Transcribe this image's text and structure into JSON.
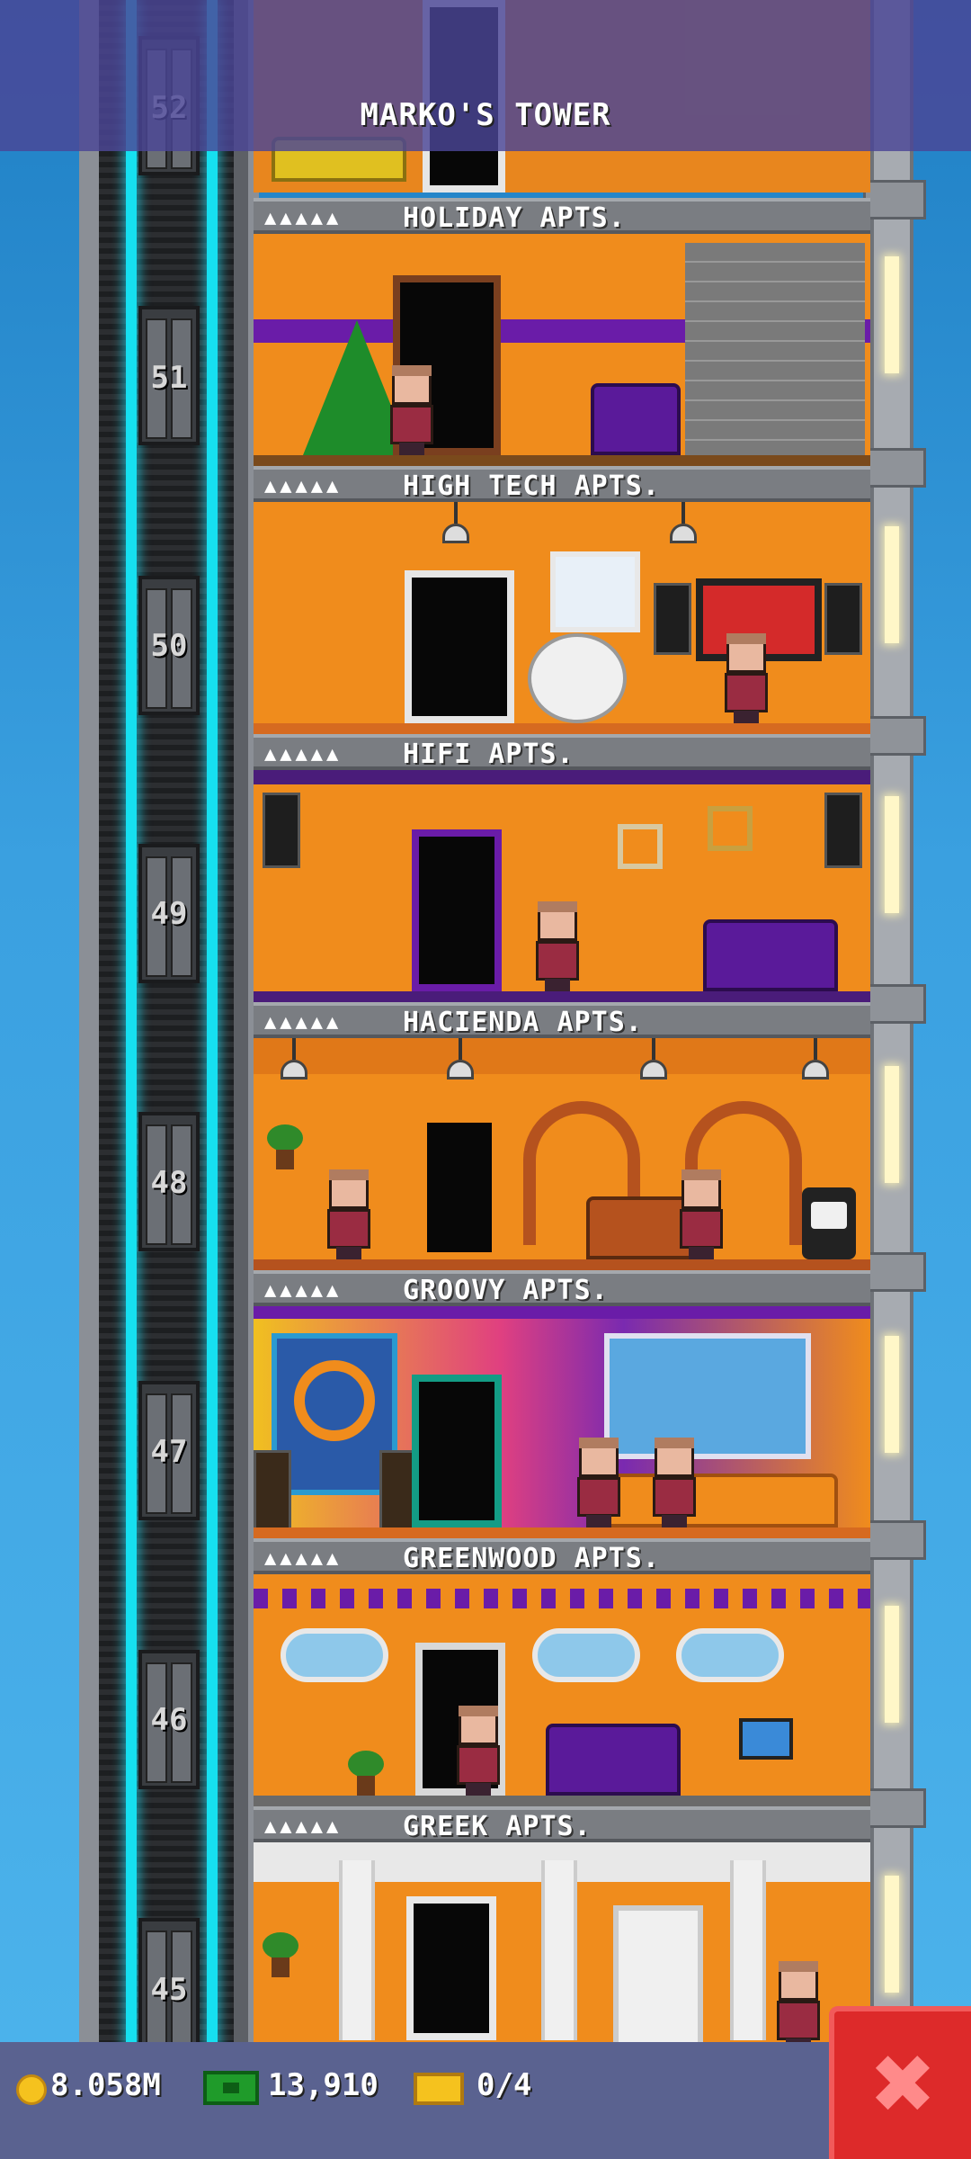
{
  "header": {
    "title": "MARKO'S TOWER"
  },
  "elevator": {
    "floor_numbers": [
      "52",
      "51",
      "50",
      "49",
      "48",
      "47",
      "46",
      "45"
    ]
  },
  "floors": [
    {
      "floor": "51",
      "dots": "▲▲▲▲▲",
      "name": "HOLIDAY APTS.",
      "theme": "holiday"
    },
    {
      "floor": "50",
      "dots": "▲▲▲▲▲",
      "name": "HIGH TECH APTS.",
      "theme": "hightech"
    },
    {
      "floor": "49",
      "dots": "▲▲▲▲▲",
      "name": "HIFI APTS.",
      "theme": "hifi"
    },
    {
      "floor": "48",
      "dots": "▲▲▲▲▲",
      "name": "HACIENDA APTS.",
      "theme": "hacienda"
    },
    {
      "floor": "47",
      "dots": "▲▲▲▲▲",
      "name": "GROOVY APTS.",
      "theme": "groovy"
    },
    {
      "floor": "46",
      "dots": "▲▲▲▲▲",
      "name": "GREENWOOD APTS.",
      "theme": "greenwood"
    },
    {
      "floor": "45",
      "dots": "▲▲▲▲▲",
      "name": "GREEK APTS.",
      "theme": "greek"
    }
  ],
  "status_bar": {
    "coins": "8.058M",
    "bux": "13,910",
    "tickets": "0/4",
    "coin_icon": "coin-icon",
    "bux_icon": "cash-icon",
    "ticket_icon": "ticket-icon"
  },
  "close_button": {
    "label": "✖",
    "icon": "close-icon"
  },
  "colors": {
    "accent": "#dd2a2a",
    "header": "#4a4696",
    "room": "#f08c1c",
    "elevator_cable": "#16e0f0"
  }
}
